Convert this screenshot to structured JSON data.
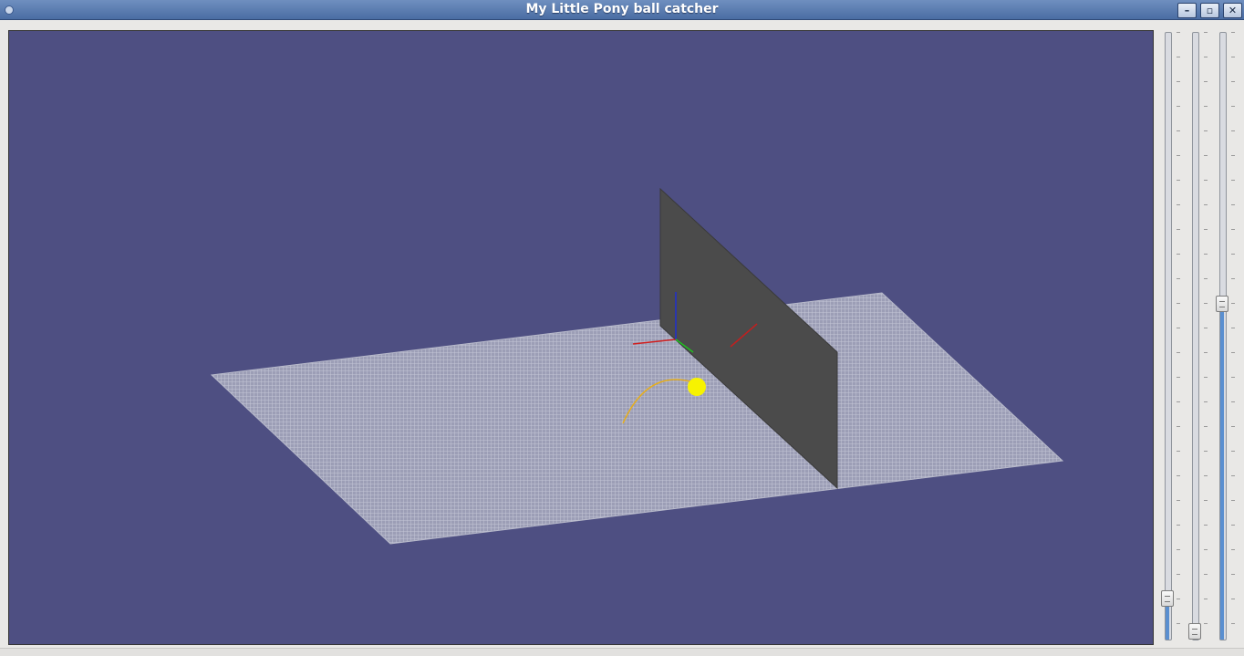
{
  "window": {
    "title": "My Little Pony ball catcher",
    "buttons": {
      "minimize": "–",
      "maximize": "▫",
      "close": "✕"
    }
  },
  "scene": {
    "background_color": "#4e4f82",
    "floor_color": "#a9abc0",
    "wall_color": "#4b4b4b",
    "ball_color": "#f7f300",
    "trajectory_color": "#e7ae1a",
    "axis_colors": {
      "x": "#d02020",
      "y": "#20c020",
      "z": "#2030d0"
    }
  },
  "sliders": [
    {
      "name": "slider-1",
      "value_fraction": 0.07
    },
    {
      "name": "slider-2",
      "value_fraction": 0.0
    },
    {
      "name": "slider-3",
      "value_fraction": 0.55
    }
  ]
}
